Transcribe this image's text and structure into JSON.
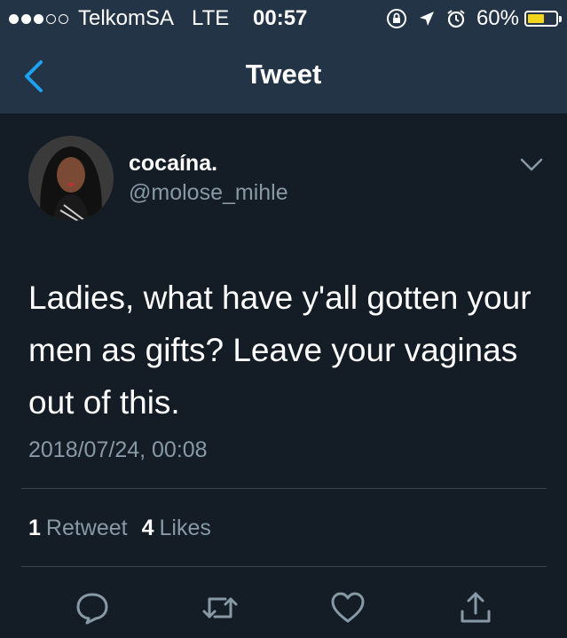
{
  "status_bar": {
    "carrier": "TelkomSA",
    "network": "LTE",
    "time": "00:57",
    "battery_percent": "60%",
    "battery_level": 0.6,
    "signal_bars_filled": 3,
    "signal_bars_total": 5,
    "icons": [
      "orientation-lock-icon",
      "location-arrow-icon",
      "alarm-icon"
    ]
  },
  "nav": {
    "title": "Tweet",
    "back_icon": "chevron-left-icon"
  },
  "tweet": {
    "display_name": "cocaína.",
    "handle": "@molose_mihle",
    "text": "Ladies, what have y'all gotten your men as gifts? Leave your vaginas out of this.",
    "timestamp": "2018/07/24, 00:08",
    "retweet_count": "1",
    "retweet_label": "Retweet",
    "like_count": "4",
    "like_label": "Likes"
  },
  "actions": [
    "reply-icon",
    "retweet-icon",
    "like-icon",
    "share-icon"
  ],
  "colors": {
    "background": "#141d26",
    "bar": "#243447",
    "accent": "#1da1f2",
    "muted": "#8899a6",
    "battery": "#f2d41c"
  }
}
